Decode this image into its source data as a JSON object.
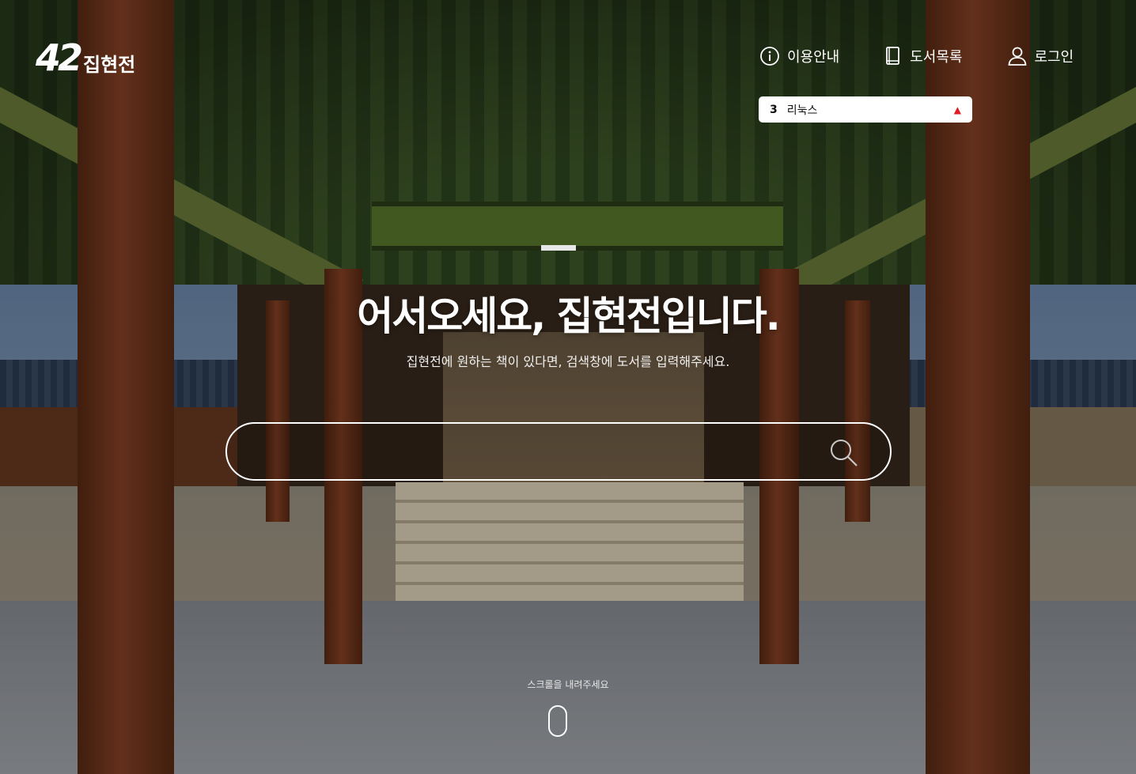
{
  "header": {
    "logo_mark": "42",
    "logo_text": "집현전",
    "nav": [
      {
        "label": "이용안내",
        "icon": "info-circle-icon"
      },
      {
        "label": "도서목록",
        "icon": "book-icon"
      },
      {
        "label": "로그인",
        "icon": "user-icon"
      }
    ]
  },
  "ranking": {
    "rank": "3",
    "keyword": "리눅스",
    "trend_icon": "triangle-up-icon",
    "trend_color": "#e01b22"
  },
  "hero": {
    "title": "어서오세요, 집현전입니다.",
    "subtitle": "집현전에 원하는 책이 있다면, 검색창에 도서를 입력해주세요."
  },
  "search": {
    "value": "",
    "placeholder": "",
    "button_icon": "search-icon"
  },
  "scroll_hint": {
    "text": "스크롤을 내려주세요",
    "icon": "mouse-icon"
  }
}
